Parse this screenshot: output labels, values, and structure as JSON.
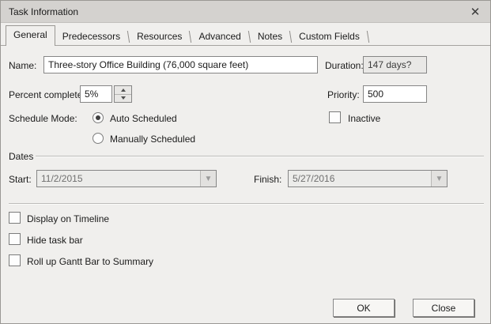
{
  "dialog": {
    "title": "Task Information"
  },
  "tabs": [
    {
      "label": "General",
      "active": true
    },
    {
      "label": "Predecessors",
      "active": false
    },
    {
      "label": "Resources",
      "active": false
    },
    {
      "label": "Advanced",
      "active": false
    },
    {
      "label": "Notes",
      "active": false
    },
    {
      "label": "Custom Fields",
      "active": false
    }
  ],
  "fields": {
    "name": {
      "label": "Name:",
      "value": "Three-story Office Building (76,000 square feet)"
    },
    "duration": {
      "label": "Duration:",
      "value": "147 days?",
      "disabled": true
    },
    "percent_complete": {
      "label": "Percent complete:",
      "value": "5%"
    },
    "priority": {
      "label": "Priority:",
      "value": "500"
    },
    "schedule_mode": {
      "label": "Schedule Mode:",
      "options": [
        {
          "label": "Auto Scheduled",
          "selected": true
        },
        {
          "label": "Manually Scheduled",
          "selected": false
        }
      ]
    },
    "inactive": {
      "label": "Inactive",
      "checked": false
    }
  },
  "dates": {
    "group_label": "Dates",
    "start": {
      "label": "Start:",
      "value": "11/2/2015",
      "disabled": true
    },
    "finish": {
      "label": "Finish:",
      "value": "5/27/2016",
      "disabled": true
    }
  },
  "options": [
    {
      "label": "Display on Timeline",
      "checked": false
    },
    {
      "label": "Hide task bar",
      "checked": false
    },
    {
      "label": "Roll up Gantt Bar to Summary",
      "checked": false
    }
  ],
  "buttons": {
    "ok": "OK",
    "close": "Close"
  },
  "colors": {
    "titlebar_bg": "#d4d2cf",
    "dialog_bg": "#f0efed",
    "disabled_field_bg": "#e9e8e6",
    "field_border": "#868686",
    "text": "#1b1b1b"
  }
}
